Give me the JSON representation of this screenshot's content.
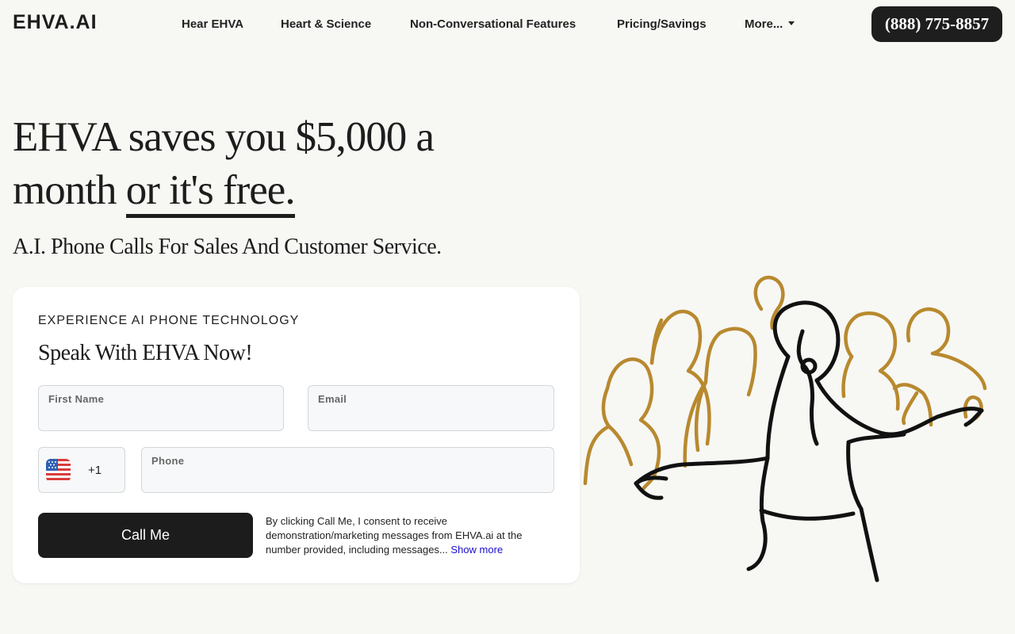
{
  "header": {
    "logo": "EHVA.AI",
    "nav": [
      {
        "label": "Hear EHVA"
      },
      {
        "label": "Heart & Science"
      },
      {
        "label": "Non-Conversational Features"
      },
      {
        "label": "Pricing/Savings"
      },
      {
        "label": "More..."
      }
    ],
    "phone": "(888) 775-8857"
  },
  "hero": {
    "title_line1": "EHVA saves you $5,000 a",
    "title_line2_plain": "month ",
    "title_line2_underlined": "or it's free.",
    "subtitle": "A.I. Phone Calls For Sales And Customer Service."
  },
  "form": {
    "eyebrow": "EXPERIENCE AI PHONE TECHNOLOGY",
    "title": "Speak With EHVA Now!",
    "first_name_label": "First Name",
    "first_name_value": "",
    "email_label": "Email",
    "email_value": "",
    "country_code": "+1",
    "phone_label": "Phone",
    "phone_value": "",
    "submit_label": "Call Me",
    "consent_text": "By clicking Call Me, I consent to receive demonstration/marketing messages from EHVA.ai at the number provided, including messages...",
    "show_more": "Show more"
  },
  "colors": {
    "background": "#f7f7f4",
    "dark": "#1e1e1e",
    "accent_gold": "#b8892e",
    "link": "#1a0dcc"
  }
}
